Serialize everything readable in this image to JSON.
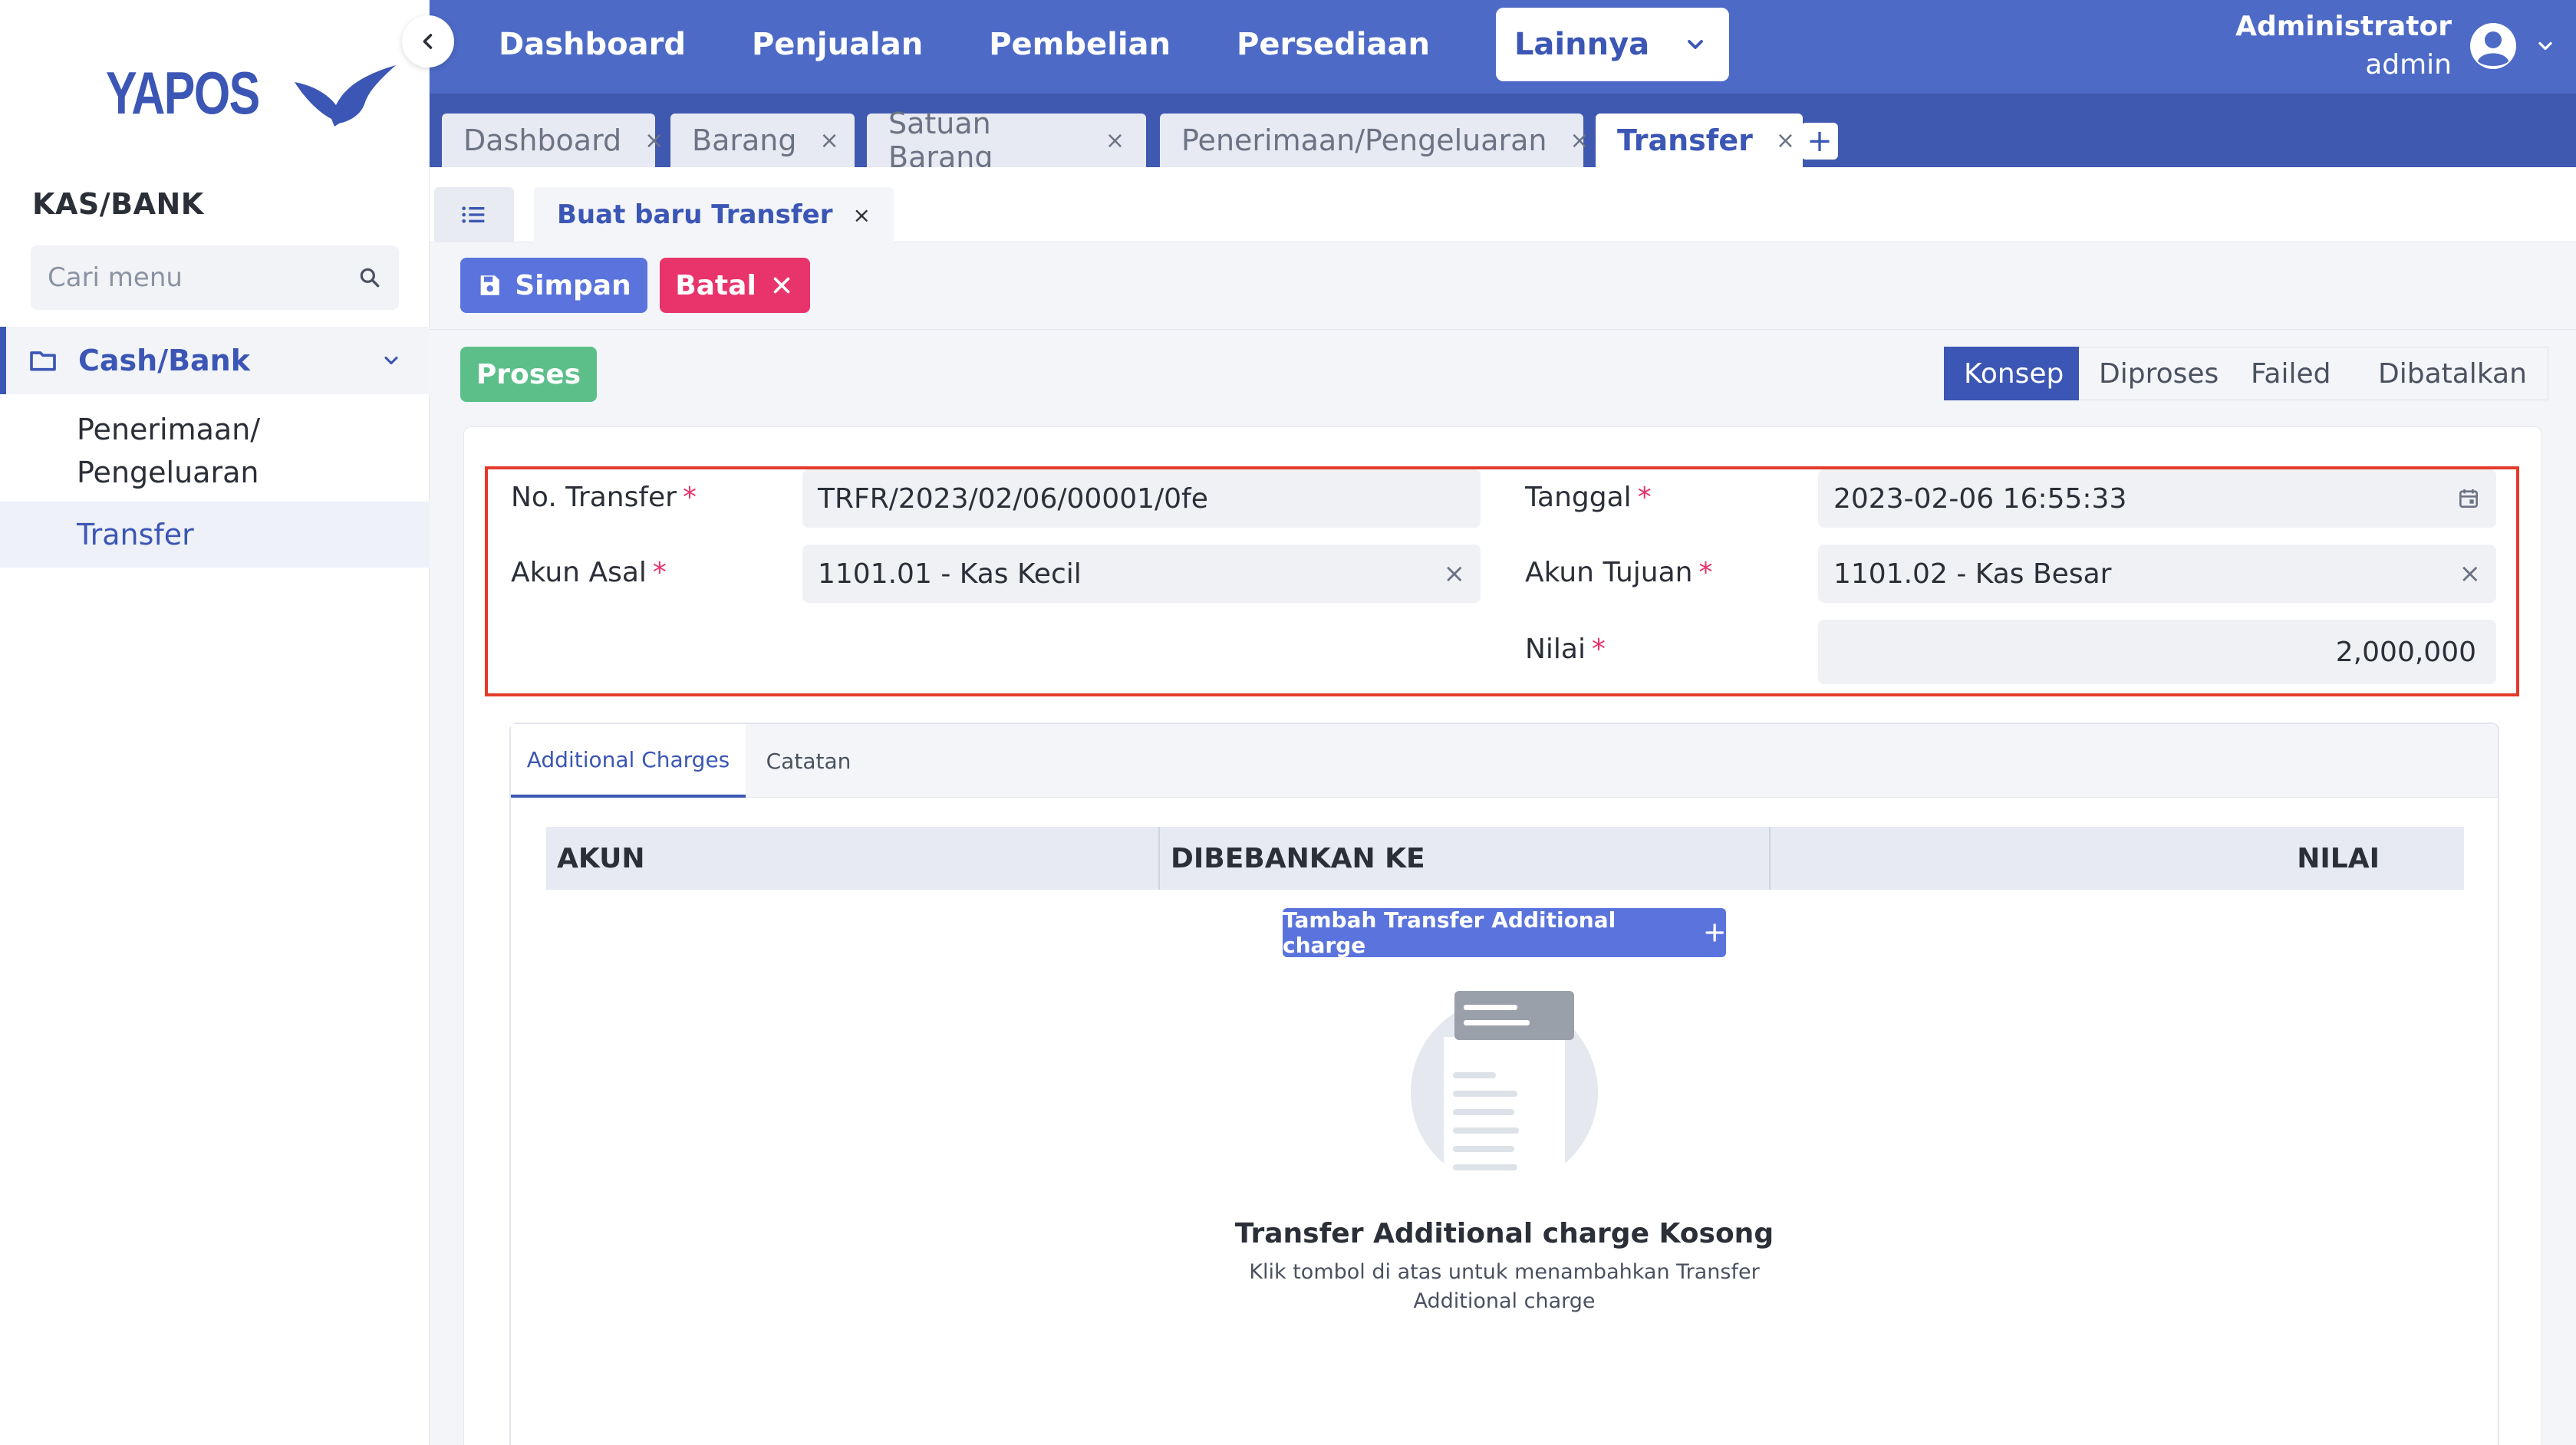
{
  "brand": {
    "name": "YAPOS",
    "color": "#3b56b4"
  },
  "sidebar": {
    "section_title": "KAS/BANK",
    "search_placeholder": "Cari menu",
    "group": {
      "label": "Cash/Bank",
      "icon": "folder-icon"
    },
    "items": [
      {
        "label_line1": "Penerimaan/",
        "label_line2": "Pengeluaran"
      },
      {
        "label": "Transfer"
      }
    ]
  },
  "topnav": {
    "items": [
      "Dashboard",
      "Penjualan",
      "Pembelian",
      "Persediaan"
    ],
    "dropdown_label": "Lainnya",
    "user_name": "Administrator",
    "user_role": "admin"
  },
  "doc_tabs": [
    "Dashboard",
    "Barang",
    "Satuan Barang",
    "Penerimaan/Pengeluaran",
    "Transfer"
  ],
  "close_glyph": "×",
  "add_glyph": "+",
  "subtab": {
    "label": "Buat baru Transfer"
  },
  "actions": {
    "save": "Simpan",
    "cancel": "Batal",
    "process": "Proses"
  },
  "status_steps": [
    "Konsep",
    "Diproses",
    "Failed",
    "Dibatalkan"
  ],
  "form": {
    "required_mark": "*",
    "no_transfer": {
      "label": "No. Transfer",
      "value": "TRFR/2023/02/06/00001/0fe"
    },
    "tanggal": {
      "label": "Tanggal",
      "value": "2023-02-06  16:55:33"
    },
    "akun_asal": {
      "label": "Akun Asal",
      "value": "1101.01 - Kas Kecil"
    },
    "akun_tujuan": {
      "label": "Akun Tujuan",
      "value": "1101.02 - Kas Besar"
    },
    "nilai": {
      "label": "Nilai",
      "value": "2,000,000"
    }
  },
  "panel": {
    "tabs": [
      "Additional Charges",
      "Catatan"
    ],
    "columns": [
      "AKUN",
      "DIBEBANKAN KE",
      "NILAI"
    ],
    "add_button": "Tambah Transfer Additional charge",
    "empty_title": "Transfer Additional charge Kosong",
    "empty_desc_line1": "Klik tombol di atas untuk menambahkan Transfer",
    "empty_desc_line2": "Additional charge"
  },
  "colors": {
    "primary": "#3b56b4",
    "topbar": "#4d6ac6",
    "save": "#5b74dd",
    "cancel": "#e8336b",
    "process": "#5cbf8a",
    "highlight": "#e23b2a"
  }
}
